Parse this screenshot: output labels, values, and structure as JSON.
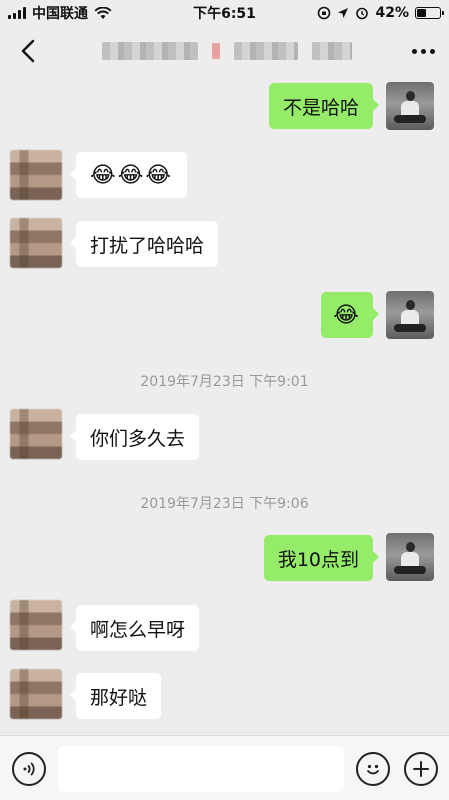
{
  "status_bar": {
    "carrier": "中国联通",
    "time": "下午6:51",
    "battery_text": "42%",
    "battery_level": 0.42
  },
  "nav": {
    "back_icon": "chevron-left-icon",
    "more_icon": "more-dots-icon"
  },
  "messages": [
    {
      "side": "out",
      "text": "不是哈哈"
    },
    {
      "side": "in",
      "text": "😂😂😂"
    },
    {
      "side": "in",
      "text": "打扰了哈哈哈"
    },
    {
      "side": "out",
      "text": "😂"
    },
    {
      "side": "in",
      "text": "你们多久去"
    },
    {
      "side": "out",
      "text": "我10点到"
    },
    {
      "side": "in",
      "text": "啊怎么早呀"
    },
    {
      "side": "in",
      "text": "那好哒"
    }
  ],
  "timestamps": [
    "2019年7月23日 下午9:01",
    "2019年7月23日 下午9:06"
  ],
  "input_bar": {
    "voice_icon": "voice-icon",
    "emoji_icon": "emoji-icon",
    "plus_icon": "plus-icon",
    "placeholder": ""
  },
  "colors": {
    "background": "#ededed",
    "bubble_out": "#95ec69",
    "bubble_in": "#ffffff"
  }
}
